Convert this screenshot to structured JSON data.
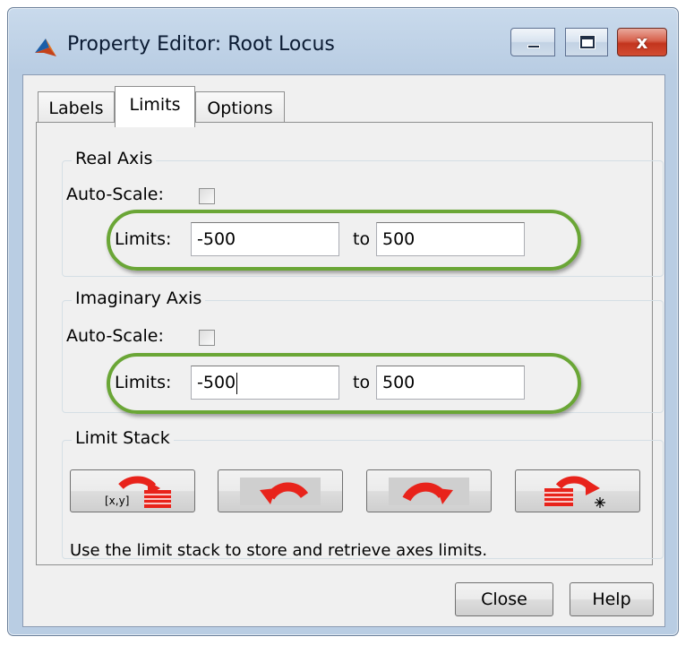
{
  "window": {
    "title": "Property Editor: Root Locus",
    "controls": {
      "minimize_icon": "minimize-icon",
      "maximize_icon": "maximize-icon",
      "close_icon": "close-icon",
      "close_glyph": "x"
    }
  },
  "tabs": [
    {
      "label": "Labels",
      "active": false
    },
    {
      "label": "Limits",
      "active": true
    },
    {
      "label": "Options",
      "active": false
    }
  ],
  "real_axis": {
    "title": "Real Axis",
    "autoscale_label": "Auto-Scale:",
    "autoscale_checked": false,
    "limits_label": "Limits:",
    "min_value": "-500",
    "to_label": "to",
    "max_value": "500"
  },
  "imaginary_axis": {
    "title": "Imaginary Axis",
    "autoscale_label": "Auto-Scale:",
    "autoscale_checked": false,
    "limits_label": "Limits:",
    "min_value": "-500",
    "to_label": "to",
    "max_value": "500"
  },
  "limit_stack": {
    "title": "Limit Stack",
    "buttons": [
      {
        "icon": "store-limits-icon",
        "glyph_text": "[x,y]"
      },
      {
        "icon": "undo-arrow-icon"
      },
      {
        "icon": "redo-arrow-icon"
      },
      {
        "icon": "clear-stack-icon"
      }
    ],
    "description": "Use the limit stack to store and retrieve axes limits."
  },
  "footer": {
    "close_label": "Close",
    "help_label": "Help"
  },
  "colors": {
    "highlight": "#6aa636",
    "arrow_red": "#e8231b",
    "close_red": "#c3341d"
  }
}
